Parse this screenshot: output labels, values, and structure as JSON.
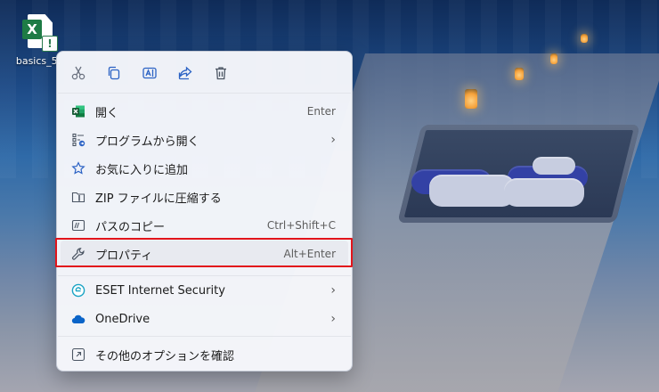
{
  "desktop": {
    "file_icon": {
      "name": "basics_5.",
      "app_letter": "X",
      "badge": "!",
      "icon": "excel-file-icon"
    }
  },
  "context_menu": {
    "toolbar": [
      {
        "icon": "cut-icon"
      },
      {
        "icon": "copy-icon"
      },
      {
        "icon": "rename-icon"
      },
      {
        "icon": "share-icon"
      },
      {
        "icon": "delete-icon"
      }
    ],
    "items": [
      {
        "label": "開く",
        "shortcut": "Enter",
        "icon": "excel-icon"
      },
      {
        "label": "プログラムから開く",
        "icon": "open-with-icon",
        "submenu": "›"
      },
      {
        "label": "お気に入りに追加",
        "icon": "star-icon"
      },
      {
        "label": "ZIP ファイルに圧縮する",
        "icon": "zip-folder-icon"
      },
      {
        "label": "パスのコピー",
        "shortcut": "Ctrl+Shift+C",
        "icon": "copy-path-icon"
      },
      {
        "label": "プロパティ",
        "shortcut": "Alt+Enter",
        "icon": "wrench-icon"
      },
      {
        "label": "ESET Internet Security",
        "icon": "eset-icon",
        "submenu": "›"
      },
      {
        "label": "OneDrive",
        "icon": "onedrive-cloud-icon",
        "submenu": "›"
      },
      {
        "label": "その他のオプションを確認",
        "icon": "more-options-icon"
      }
    ]
  },
  "colors": {
    "accent": "#2b62c4",
    "highlight_border": "#e2141b",
    "excel_green": "#1e7b45",
    "onedrive_blue": "#0a64c8"
  }
}
